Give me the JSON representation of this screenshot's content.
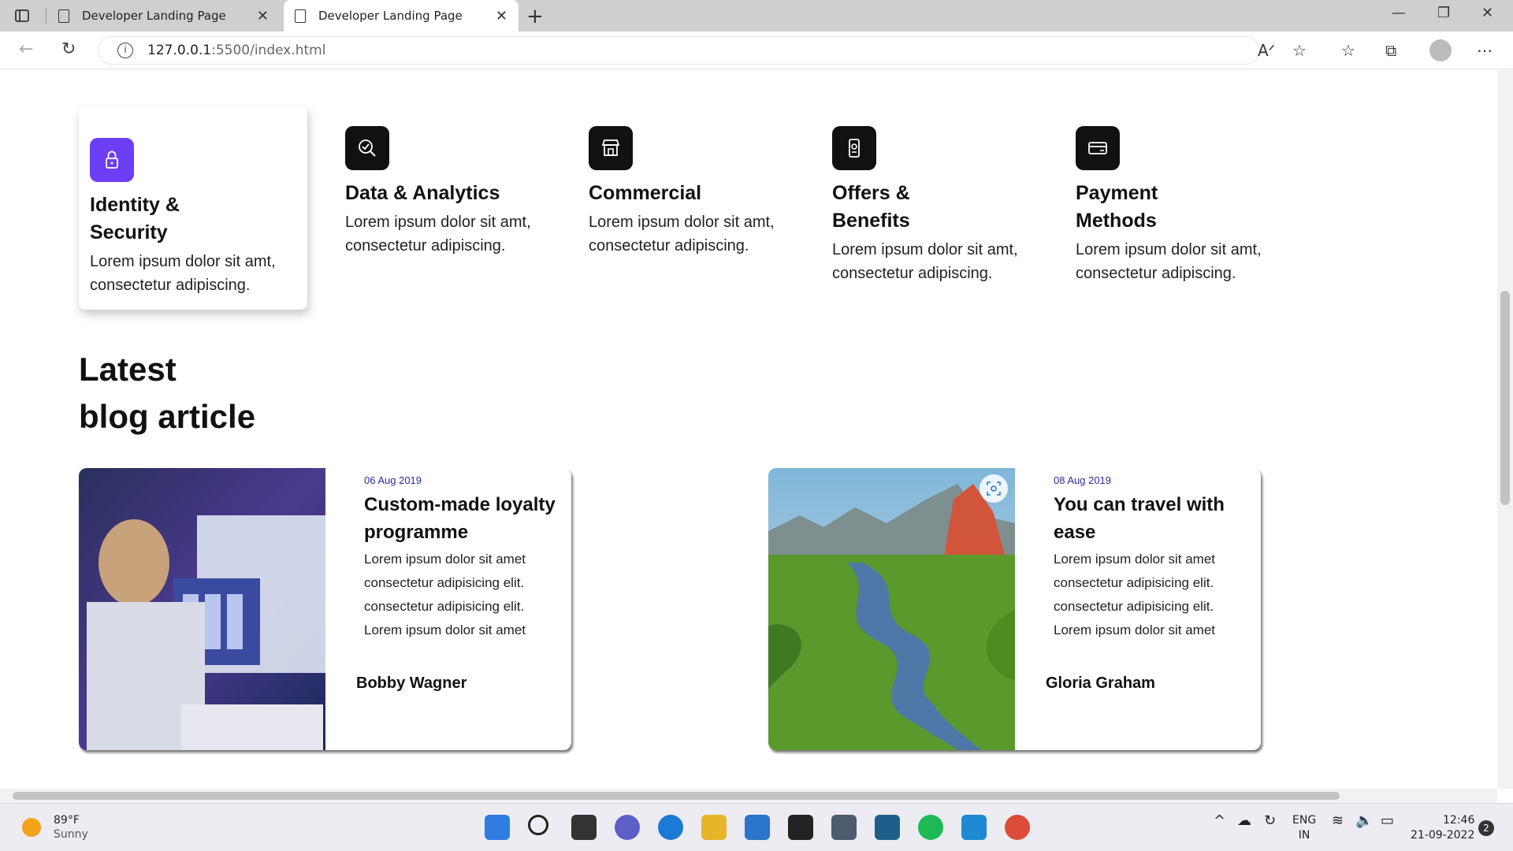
{
  "browser": {
    "tabs": [
      {
        "title": "Developer Landing Page",
        "active": false
      },
      {
        "title": "Developer Landing Page",
        "active": true
      }
    ],
    "url_host": "127.0.0.1",
    "url_rest": ":5500/index.html"
  },
  "features": [
    {
      "title": "Identity & Security",
      "desc": "Lorem ipsum dolor sit amt, consectetur adipiscing.",
      "icon": "lock-icon"
    },
    {
      "title": "Data & Analytics",
      "desc": "Lorem ipsum dolor sit amt, consectetur adipiscing.",
      "icon": "analytics-icon"
    },
    {
      "title": "Commercial",
      "desc": "Lorem ipsum dolor sit amt, consectetur adipiscing.",
      "icon": "store-icon"
    },
    {
      "title": "Offers & Benefits",
      "desc": "Lorem ipsum dolor sit amt, consectetur adipiscing.",
      "icon": "offer-icon"
    },
    {
      "title": "Payment Methods",
      "desc": "Lorem ipsum dolor sit amt, consectetur adipiscing.",
      "icon": "card-icon"
    }
  ],
  "blog_section": {
    "title_line1": "Latest",
    "title_line2": "blog article"
  },
  "blog_posts": [
    {
      "date": "06 Aug 2019",
      "title": "Custom-made loyalty programme",
      "body_lines": [
        "Lorem ipsum dolor sit amet",
        "consectetur adipisicing elit.",
        "consectetur adipisicing elit.",
        "Lorem ipsum dolor sit amet"
      ],
      "author": "Bobby Wagner"
    },
    {
      "date": "08 Aug 2019",
      "title": "You can travel with ease",
      "body_lines": [
        "Lorem ipsum dolor sit amet",
        "consectetur adipisicing elit.",
        "consectetur adipisicing elit.",
        "Lorem ipsum dolor sit amet"
      ],
      "author": "Gloria Graham"
    }
  ],
  "taskbar": {
    "weather_temp": "89°F",
    "weather_desc": "Sunny",
    "lang_line1": "ENG",
    "lang_line2": "IN",
    "time": "12:46",
    "date": "21-09-2022",
    "notif_count": "2"
  },
  "colors": {
    "accent": "#6c3ef5",
    "date_blue": "#2a2aa0"
  }
}
